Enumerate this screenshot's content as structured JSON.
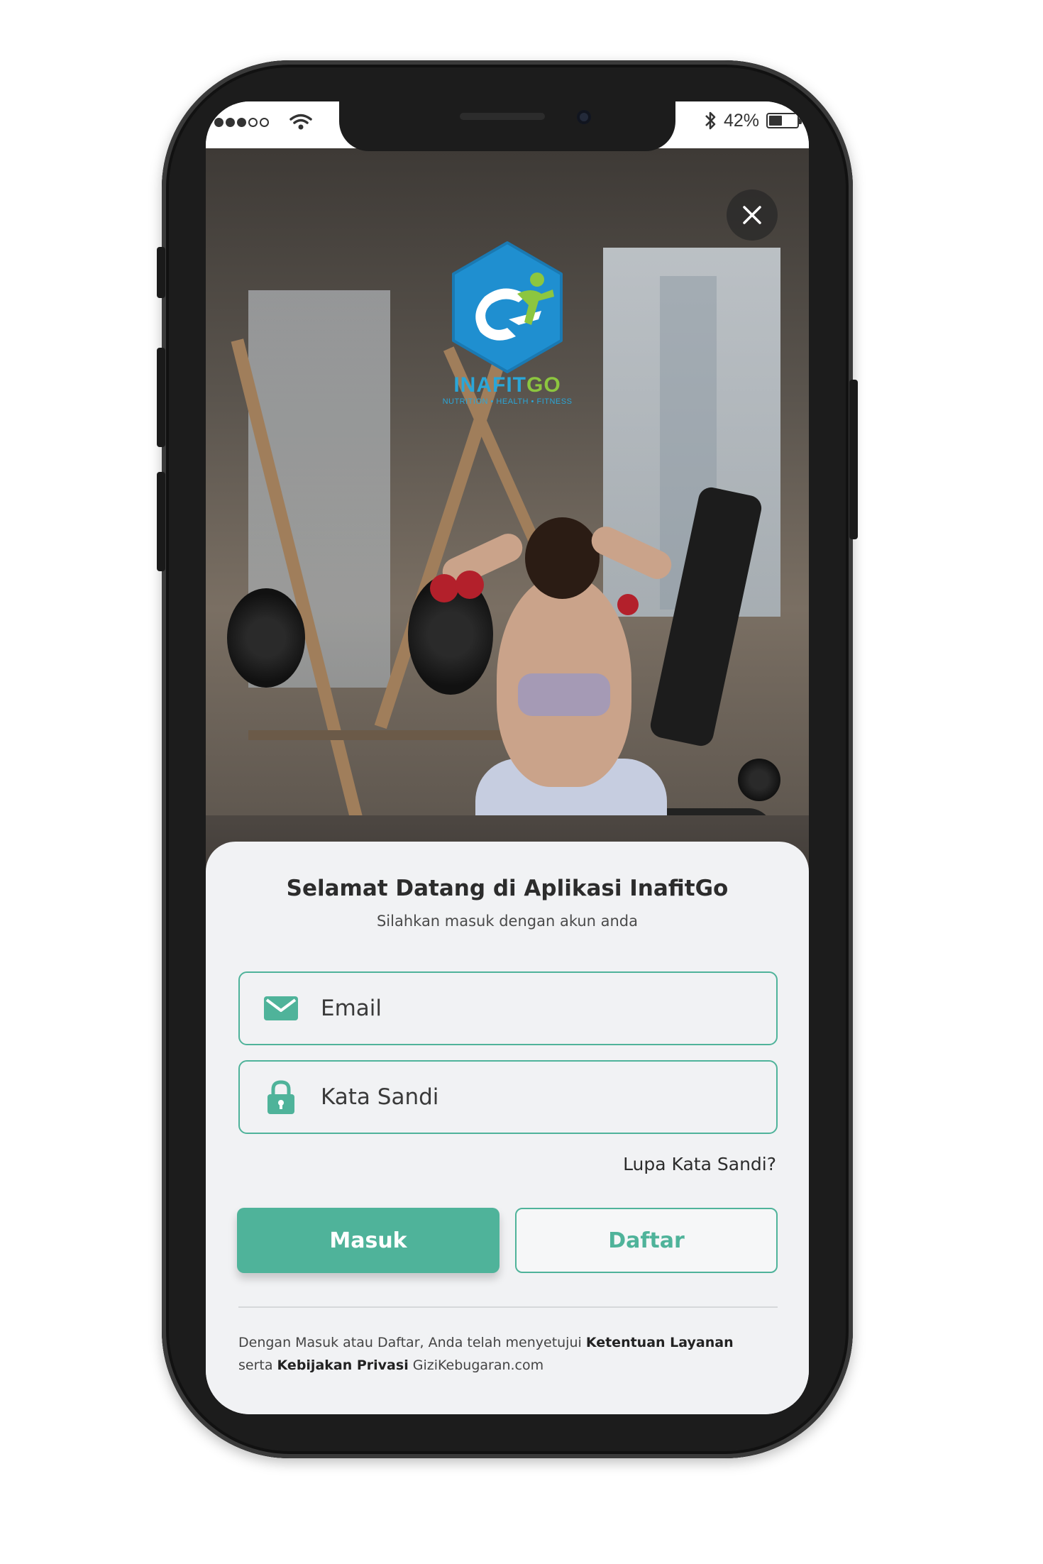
{
  "status_bar": {
    "battery": "42%"
  },
  "logo": {
    "name_part1": "INAFIT",
    "name_part2": "GO",
    "tagline": "NUTRITION • HEALTH • FITNESS"
  },
  "card": {
    "title": "Selamat Datang di Aplikasi InafitGo",
    "subtitle": "Silahkan masuk dengan akun anda",
    "email_placeholder": "Email",
    "password_placeholder": "Kata Sandi",
    "forgot_label": "Lupa Kata Sandi?",
    "login_label": "Masuk",
    "register_label": "Daftar",
    "terms": {
      "part1": "Dengan Masuk atau Daftar, Anda telah menyetujui ",
      "link1": "Ketentuan Layanan",
      "part2": "serta ",
      "link2": "Kebijakan Privasi",
      "part3": " GiziKebugaran.com"
    }
  },
  "colors": {
    "accent": "#4fb39a",
    "logo_blue": "#2aa6d8",
    "logo_green": "#8cc63f"
  }
}
